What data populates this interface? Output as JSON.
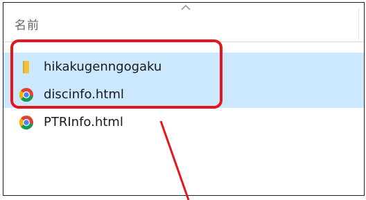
{
  "list": {
    "column_header": "名前",
    "sort_direction": "ascending",
    "items": [
      {
        "name": "hikakugenngogaku",
        "type": "folder",
        "icon": "folder-icon",
        "selected": true
      },
      {
        "name": "discinfo.html",
        "type": "html",
        "icon": "chrome-icon",
        "selected": true
      },
      {
        "name": "PTRInfo.html",
        "type": "html",
        "icon": "chrome-icon",
        "selected": false
      }
    ]
  },
  "annotation": {
    "color": "#e4161b",
    "shape": "rounded-rectangle-with-pointer-line"
  },
  "colors": {
    "selection": "#cce8ff",
    "folder": "#f5c143"
  }
}
